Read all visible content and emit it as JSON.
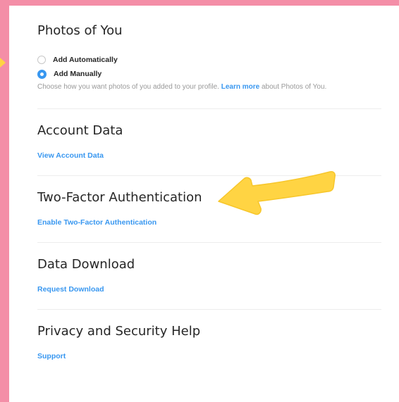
{
  "photos_of_you": {
    "title": "Photos of You",
    "options": [
      {
        "label": "Add Automatically",
        "checked": false
      },
      {
        "label": "Add Manually",
        "checked": true
      }
    ],
    "helper_before": "Choose how you want photos of you added to your profile. ",
    "helper_link": "Learn more",
    "helper_after": " about Photos of You."
  },
  "account_data": {
    "title": "Account Data",
    "link": "View Account Data"
  },
  "two_factor": {
    "title": "Two-Factor Authentication",
    "link": "Enable Two-Factor Authentication"
  },
  "data_download": {
    "title": "Data Download",
    "link": "Request Download"
  },
  "privacy_help": {
    "title": "Privacy and Security Help",
    "link": "Support"
  },
  "colors": {
    "link_blue": "#3897f0",
    "annotation_yellow": "#ffd443",
    "background_pink": "#f48ea7"
  }
}
